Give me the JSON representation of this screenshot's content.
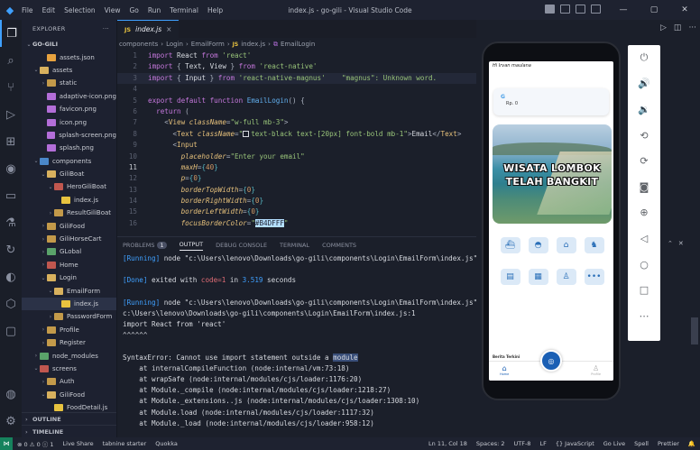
{
  "window": {
    "title": "index.js - go-gili - Visual Studio Code",
    "menu": [
      "File",
      "Edit",
      "Selection",
      "View",
      "Go",
      "Run",
      "Terminal",
      "Help"
    ],
    "controls": [
      "—",
      "▢",
      "✕"
    ]
  },
  "activity_bar": {
    "icons": [
      "files-icon",
      "search-icon",
      "source-control-icon",
      "run-debug-icon",
      "extensions-icon",
      "github-icon",
      "remote-explorer-icon",
      "testing-icon",
      "live-share-icon",
      "edge-icon",
      "docker-icon",
      "chat-icon"
    ],
    "bottom_icons": [
      "account-icon",
      "settings-icon"
    ]
  },
  "sidebar": {
    "header": "EXPLORER",
    "header_more": "···",
    "root": "GO-GILI",
    "tree": [
      {
        "label": "assets.json",
        "depth": 2,
        "type": "json",
        "chev": ""
      },
      {
        "label": "assets",
        "depth": 1,
        "type": "folder-open",
        "chev": "⌄"
      },
      {
        "label": "static",
        "depth": 2,
        "type": "folder",
        "chev": "›"
      },
      {
        "label": "adaptive-icon.png",
        "depth": 2,
        "type": "png",
        "chev": ""
      },
      {
        "label": "favicon.png",
        "depth": 2,
        "type": "png",
        "chev": ""
      },
      {
        "label": "icon.png",
        "depth": 2,
        "type": "png",
        "chev": ""
      },
      {
        "label": "splash-screen.png",
        "depth": 2,
        "type": "png",
        "chev": ""
      },
      {
        "label": "splash.png",
        "depth": 2,
        "type": "png",
        "chev": ""
      },
      {
        "label": "components",
        "depth": 1,
        "type": "folder-open blue",
        "chev": "⌄"
      },
      {
        "label": "GiliBoat",
        "depth": 2,
        "type": "folder-open",
        "chev": "⌄"
      },
      {
        "label": "HeroGiliBoat",
        "depth": 3,
        "type": "folder-open red",
        "chev": "⌄"
      },
      {
        "label": "index.js",
        "depth": 4,
        "type": "js",
        "chev": ""
      },
      {
        "label": "ResultGiliBoat",
        "depth": 3,
        "type": "folder",
        "chev": "›"
      },
      {
        "label": "GiliFood",
        "depth": 2,
        "type": "folder",
        "chev": "›"
      },
      {
        "label": "GiliHorseCart",
        "depth": 2,
        "type": "folder",
        "chev": "›"
      },
      {
        "label": "GLobal",
        "depth": 2,
        "type": "folder green",
        "chev": "›"
      },
      {
        "label": "Home",
        "depth": 2,
        "type": "folder red",
        "chev": "›"
      },
      {
        "label": "Login",
        "depth": 2,
        "type": "folder-open",
        "chev": "⌄"
      },
      {
        "label": "EmailForm",
        "depth": 3,
        "type": "folder-open",
        "chev": "⌄"
      },
      {
        "label": "index.js",
        "depth": 4,
        "type": "js",
        "chev": "",
        "selected": true
      },
      {
        "label": "PasswordForm",
        "depth": 3,
        "type": "folder",
        "chev": "›"
      },
      {
        "label": "Profile",
        "depth": 2,
        "type": "folder",
        "chev": "›"
      },
      {
        "label": "Register",
        "depth": 2,
        "type": "folder",
        "chev": "›"
      },
      {
        "label": "node_modules",
        "depth": 1,
        "type": "folder green",
        "chev": "›"
      },
      {
        "label": "screens",
        "depth": 1,
        "type": "folder-open red",
        "chev": "⌄"
      },
      {
        "label": "Auth",
        "depth": 2,
        "type": "folder",
        "chev": "›"
      },
      {
        "label": "GiliFood",
        "depth": 2,
        "type": "folder-open",
        "chev": "⌄"
      },
      {
        "label": "FoodDetail.js",
        "depth": 3,
        "type": "js",
        "chev": ""
      }
    ],
    "outline": "OUTLINE",
    "timeline": "TIMELINE"
  },
  "editor": {
    "tab_label": "index.js",
    "tab_close": "×",
    "breadcrumb": [
      "components",
      "Login",
      "EmailForm",
      "index.js",
      "EmailLogin"
    ],
    "current_line": 11
  },
  "panel": {
    "tabs": [
      "PROBLEMS",
      "OUTPUT",
      "DEBUG CONSOLE",
      "TERMINAL",
      "COMMENTS"
    ],
    "problems_count": "1",
    "active_tab": "OUTPUT"
  },
  "phone": {
    "user_name": "Hi Irvan maulana",
    "balance_logo": "G",
    "balance": "Rp. 0",
    "banner_line1": "WISATA LOMBOK",
    "banner_line2": "TELAH BANGKIT",
    "section_title": "Berita Terkini",
    "nav_home": "Home",
    "nav_profile": "Profile"
  },
  "emulator_toolbar": {
    "icons": [
      "power-icon",
      "volume-up-icon",
      "volume-down-icon",
      "rotate-left-icon",
      "rotate-right-icon",
      "camera-icon",
      "zoom-icon",
      "back-icon",
      "home-icon",
      "overview-icon",
      "more-icon"
    ]
  },
  "statusbar": {
    "left": [
      "⊗ 0 ⚠ 0 ⓘ 1",
      "Live Share",
      "tabnine starter",
      "Quokka"
    ],
    "right": [
      "Ln 11, Col 18",
      "Spaces: 2",
      "UTF-8",
      "LF",
      "{} JavaScript",
      "Go Live",
      "Spell",
      "Prettier"
    ]
  },
  "colors": {
    "accent": "#3fa0ff",
    "focus_border_color": "#B4DFFF"
  }
}
